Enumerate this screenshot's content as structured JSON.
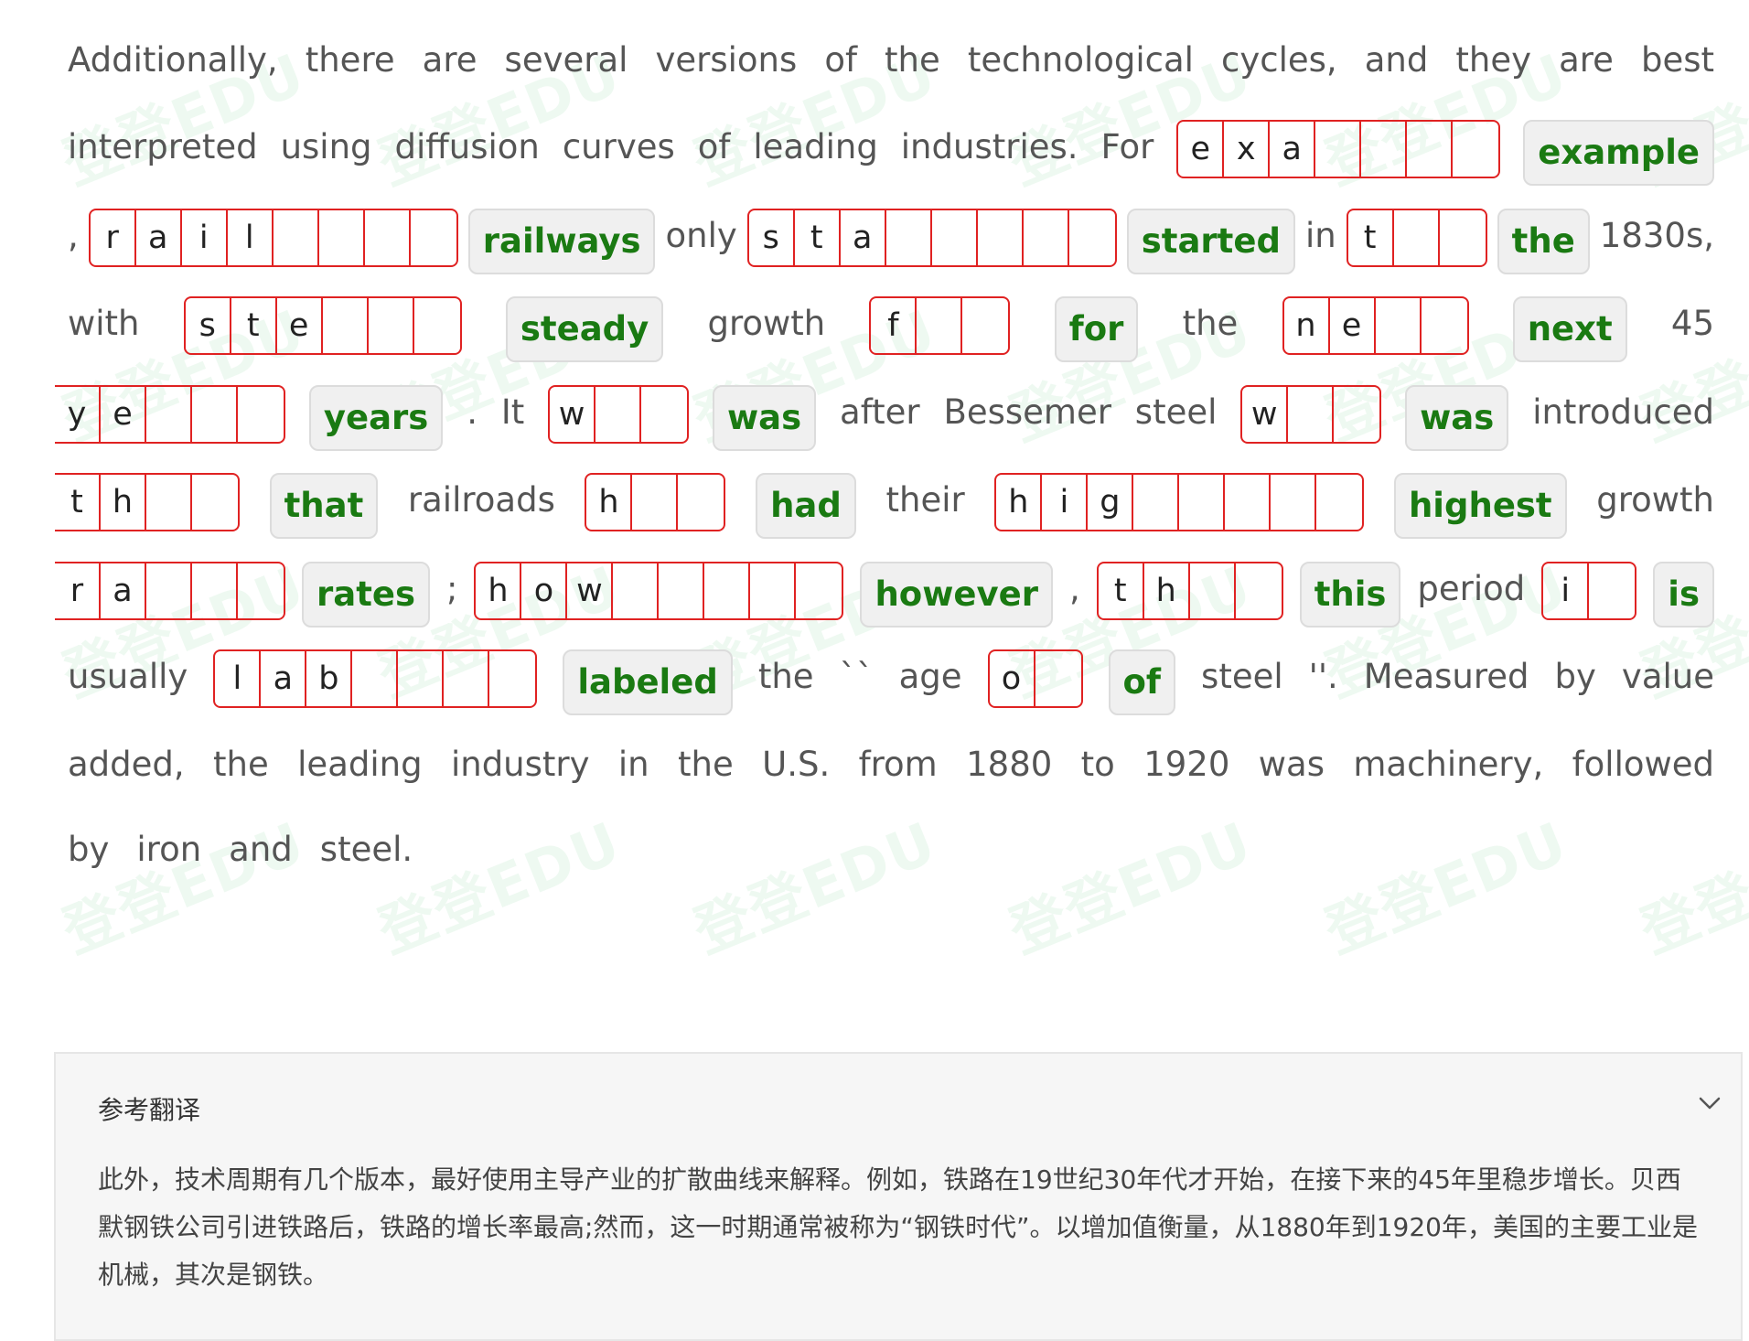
{
  "watermark_text": "登登EDU",
  "passage": {
    "lines": [
      {
        "items": [
          {
            "t": "w",
            "v": "Additionally,"
          },
          {
            "t": "w",
            "v": "there"
          },
          {
            "t": "w",
            "v": "are"
          },
          {
            "t": "w",
            "v": "several"
          },
          {
            "t": "w",
            "v": "versions"
          },
          {
            "t": "w",
            "v": "of"
          },
          {
            "t": "w",
            "v": "the"
          },
          {
            "t": "w",
            "v": "technological"
          },
          {
            "t": "w",
            "v": "cycles,"
          },
          {
            "t": "w",
            "v": "and"
          },
          {
            "t": "w",
            "v": "they"
          },
          {
            "t": "w",
            "v": "are"
          },
          {
            "t": "w",
            "v": "best"
          }
        ]
      },
      {
        "items": [
          {
            "t": "w",
            "v": "interpreted"
          },
          {
            "t": "w",
            "v": "using"
          },
          {
            "t": "w",
            "v": "diffusion"
          },
          {
            "t": "w",
            "v": "curves"
          },
          {
            "t": "w",
            "v": "of"
          },
          {
            "t": "w",
            "v": "leading"
          },
          {
            "t": "w",
            "v": "industries."
          },
          {
            "t": "w",
            "v": "For"
          },
          {
            "t": "g",
            "cells": [
              "e",
              "x",
              "a",
              "",
              "",
              "",
              ""
            ]
          },
          {
            "t": "a",
            "v": "example"
          }
        ]
      },
      {
        "items": [
          {
            "t": "w",
            "v": ","
          },
          {
            "t": "g",
            "cells": [
              "r",
              "a",
              "i",
              "l",
              "",
              "",
              "",
              ""
            ]
          },
          {
            "t": "a",
            "v": "railways"
          },
          {
            "t": "w",
            "v": "only"
          },
          {
            "t": "g",
            "cells": [
              "s",
              "t",
              "a",
              "",
              "",
              "",
              "",
              ""
            ]
          },
          {
            "t": "a",
            "v": "started"
          },
          {
            "t": "w",
            "v": "in"
          },
          {
            "t": "g",
            "cells": [
              "t",
              "",
              ""
            ]
          },
          {
            "t": "a",
            "v": "the"
          },
          {
            "t": "w",
            "v": "1830s,"
          }
        ]
      },
      {
        "items": [
          {
            "t": "w",
            "v": "with"
          },
          {
            "t": "g",
            "cells": [
              "s",
              "t",
              "e",
              "",
              "",
              ""
            ]
          },
          {
            "t": "a",
            "v": "steady"
          },
          {
            "t": "w",
            "v": "growth"
          },
          {
            "t": "g",
            "cells": [
              "f",
              "",
              ""
            ]
          },
          {
            "t": "a",
            "v": "for"
          },
          {
            "t": "w",
            "v": "the"
          },
          {
            "t": "g",
            "cells": [
              "n",
              "e",
              "",
              ""
            ]
          },
          {
            "t": "a",
            "v": "next"
          },
          {
            "t": "w",
            "v": "45"
          }
        ]
      },
      {
        "items": [
          {
            "t": "g",
            "cut": true,
            "cells": [
              "y",
              "e",
              "",
              "",
              ""
            ]
          },
          {
            "t": "a",
            "v": "years"
          },
          {
            "t": "w",
            "v": "."
          },
          {
            "t": "w",
            "v": "It"
          },
          {
            "t": "g",
            "cells": [
              "w",
              "",
              ""
            ]
          },
          {
            "t": "a",
            "v": "was"
          },
          {
            "t": "w",
            "v": "after"
          },
          {
            "t": "w",
            "v": "Bessemer"
          },
          {
            "t": "w",
            "v": "steel"
          },
          {
            "t": "g",
            "cells": [
              "w",
              "",
              ""
            ]
          },
          {
            "t": "a",
            "v": "was"
          },
          {
            "t": "w",
            "v": "introduced"
          }
        ]
      },
      {
        "items": [
          {
            "t": "g",
            "cut": true,
            "cells": [
              "t",
              "h",
              "",
              ""
            ]
          },
          {
            "t": "a",
            "v": "that"
          },
          {
            "t": "w",
            "v": "railroads"
          },
          {
            "t": "g",
            "cells": [
              "h",
              "",
              ""
            ]
          },
          {
            "t": "a",
            "v": "had"
          },
          {
            "t": "w",
            "v": "their"
          },
          {
            "t": "g",
            "cells": [
              "h",
              "i",
              "g",
              "",
              "",
              "",
              "",
              ""
            ]
          },
          {
            "t": "a",
            "v": "highest"
          },
          {
            "t": "w",
            "v": "growth"
          }
        ]
      },
      {
        "items": [
          {
            "t": "g",
            "cut": true,
            "cells": [
              "r",
              "a",
              "",
              "",
              ""
            ]
          },
          {
            "t": "a",
            "v": "rates"
          },
          {
            "t": "w",
            "v": ";"
          },
          {
            "t": "g",
            "cells": [
              "h",
              "o",
              "w",
              "",
              "",
              "",
              "",
              ""
            ]
          },
          {
            "t": "a",
            "v": "however"
          },
          {
            "t": "w",
            "v": ","
          },
          {
            "t": "g",
            "cells": [
              "t",
              "h",
              "",
              ""
            ]
          },
          {
            "t": "a",
            "v": "this"
          },
          {
            "t": "w",
            "v": "period"
          },
          {
            "t": "g",
            "cells": [
              "i",
              ""
            ]
          },
          {
            "t": "a",
            "v": "is"
          }
        ]
      },
      {
        "items": [
          {
            "t": "w",
            "v": "usually"
          },
          {
            "t": "g",
            "cells": [
              "l",
              "a",
              "b",
              "",
              "",
              "",
              ""
            ]
          },
          {
            "t": "a",
            "v": "labeled"
          },
          {
            "t": "w",
            "v": "the"
          },
          {
            "t": "w",
            "v": "``"
          },
          {
            "t": "w",
            "v": "age"
          },
          {
            "t": "g",
            "cells": [
              "o",
              ""
            ]
          },
          {
            "t": "a",
            "v": "of"
          },
          {
            "t": "w",
            "v": "steel"
          },
          {
            "t": "w",
            "v": "''."
          },
          {
            "t": "w",
            "v": "Measured"
          },
          {
            "t": "w",
            "v": "by"
          },
          {
            "t": "w",
            "v": "value"
          }
        ]
      },
      {
        "items": [
          {
            "t": "w",
            "v": "added,"
          },
          {
            "t": "w",
            "v": "the"
          },
          {
            "t": "w",
            "v": "leading"
          },
          {
            "t": "w",
            "v": "industry"
          },
          {
            "t": "w",
            "v": "in"
          },
          {
            "t": "w",
            "v": "the"
          },
          {
            "t": "w",
            "v": "U.S."
          },
          {
            "t": "w",
            "v": "from"
          },
          {
            "t": "w",
            "v": "1880"
          },
          {
            "t": "w",
            "v": "to"
          },
          {
            "t": "w",
            "v": "1920"
          },
          {
            "t": "w",
            "v": "was"
          },
          {
            "t": "w",
            "v": "machinery,"
          },
          {
            "t": "w",
            "v": "followed"
          }
        ]
      },
      {
        "items": [
          {
            "t": "w",
            "v": "by"
          },
          {
            "t": "w",
            "v": "iron"
          },
          {
            "t": "w",
            "v": "and"
          },
          {
            "t": "w",
            "v": "steel."
          }
        ]
      }
    ]
  },
  "translation": {
    "title": "参考翻译",
    "text": "此外，技术周期有几个版本，最好使用主导产业的扩散曲线来解释。例如，铁路在19世纪30年代才开始，在接下来的45年里稳步增长。贝西默钢铁公司引进铁路后，铁路的增长率最高;然而，这一时期通常被称为“钢铁时代”。以增加值衡量，从1880年到1920年，美国的主要工业是机械，其次是钢铁。"
  }
}
